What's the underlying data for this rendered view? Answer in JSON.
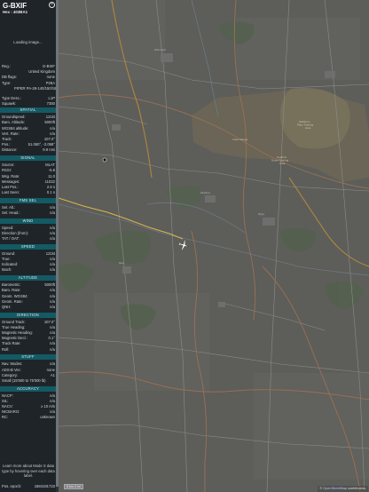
{
  "aircraft": {
    "callsign": "G-BXIF",
    "hex_label": "Hex :",
    "hex_value": "403BA1",
    "loading": "Loading image..."
  },
  "info_rows": [
    {
      "label": "Reg.:",
      "value": "G-BXIF"
    },
    {
      "label": "",
      "value": "United Kingdom"
    },
    {
      "label": "DB flags:",
      "value": "none"
    },
    {
      "label": "Type:",
      "value": "P28A"
    },
    {
      "label": "",
      "value": "PIPER PA-28-140/150/160/180"
    },
    {
      "label": "Type Desc.:",
      "value": "L1P"
    },
    {
      "label": "Squawk:",
      "value": "7350"
    }
  ],
  "sections": [
    {
      "title": "SPATIAL",
      "rows": [
        {
          "label": "Groundspeed:",
          "value": "121kt"
        },
        {
          "label": "Baro. Altitude:",
          "value": "5000ft"
        },
        {
          "label": "WGS84 altitude:",
          "value": "n/a"
        },
        {
          "label": "Vert. Rate:",
          "value": "n/a"
        },
        {
          "label": "Track:",
          "value": "107.0°"
        },
        {
          "label": "Pos.:",
          "value": "51.060°, -2.068°"
        },
        {
          "label": "Distance:",
          "value": "9.9 nmi"
        }
      ]
    },
    {
      "title": "SIGNAL",
      "rows": [
        {
          "label": "Source:",
          "value": "MLAT"
        },
        {
          "label": "RSSI:",
          "value": "-5.8"
        },
        {
          "label": "Msg. Rate:",
          "value": "11.0"
        },
        {
          "label": "Messages:",
          "value": "11022"
        },
        {
          "label": "Last Pos.:",
          "value": "2.8 s"
        },
        {
          "label": "Last Seen:",
          "value": "0.1 s"
        }
      ]
    },
    {
      "title": "FMS SEL",
      "rows": [
        {
          "label": "Sel. Alt.:",
          "value": "n/a"
        },
        {
          "label": "Sel. Head.:",
          "value": "n/a"
        }
      ]
    },
    {
      "title": "WIND",
      "rows": [
        {
          "label": "Speed:",
          "value": "n/a"
        },
        {
          "label": "Direction (from):",
          "value": "n/a"
        },
        {
          "label": "TAT / OAT:",
          "value": "n/a"
        }
      ]
    },
    {
      "title": "SPEED",
      "rows": [
        {
          "label": "Ground:",
          "value": "121kt"
        },
        {
          "label": "True:",
          "value": "n/a"
        },
        {
          "label": "Indicated:",
          "value": "n/a"
        },
        {
          "label": "Mach:",
          "value": "n/a"
        }
      ]
    },
    {
      "title": "ALTITUDE",
      "rows": [
        {
          "label": "Barometric:",
          "value": "5000ft"
        },
        {
          "label": "Baro. Rate:",
          "value": "n/a"
        },
        {
          "label": "Geom. WGS84:",
          "value": "n/a"
        },
        {
          "label": "Geom. Rate:",
          "value": "n/a"
        },
        {
          "label": "QNH:",
          "value": "n/a"
        }
      ]
    },
    {
      "title": "DIRECTION",
      "rows": [
        {
          "label": "Ground Track:",
          "value": "107.0°"
        },
        {
          "label": "True Heading:",
          "value": "n/a"
        },
        {
          "label": "Magnetic Heading:",
          "value": "n/a"
        },
        {
          "label": "Magnetic Decl.:",
          "value": "0.1°"
        },
        {
          "label": "Track Rate:",
          "value": "n/a"
        },
        {
          "label": "Roll:",
          "value": "n/a"
        }
      ]
    },
    {
      "title": "STUFF",
      "rows": [
        {
          "label": "Nav. Modes:",
          "value": "n/a"
        },
        {
          "label": "ADS-B Ver.:",
          "value": "none"
        },
        {
          "label": "Category:",
          "value": "A1"
        },
        {
          "label": "Small (15'500 to 75'000 lb)",
          "value": ""
        }
      ]
    },
    {
      "title": "ACCURACY",
      "rows": [
        {
          "label": "NACP:",
          "value": "n/a"
        },
        {
          "label": "SIL:",
          "value": "n/a"
        },
        {
          "label": "NACV:",
          "value": "≥ 10 m/s"
        },
        {
          "label": "NICBARO:",
          "value": "n/a"
        },
        {
          "label": "RC:",
          "value": "unknown"
        }
      ]
    }
  ],
  "footer": {
    "note": "Learn more about Mode S data type by hovering over each data label.",
    "pos_epoch_label": "Pos. epoch:",
    "pos_epoch_value": "1684191723"
  },
  "map": {
    "scale_label": "5 km  3 mi",
    "attribution_prefix": "© ",
    "attribution_link": "OpenStreetMap",
    "attribution_suffix": " contributors.",
    "place_labels": [
      "Salisbury Plain Training Area",
      "Battlesbury",
      "Imber Range",
      "Codford Down Training Area"
    ],
    "track_color": "#d9b84a",
    "aircraft_color": "#ffffff",
    "overlay_color": "#5e5e5e"
  }
}
